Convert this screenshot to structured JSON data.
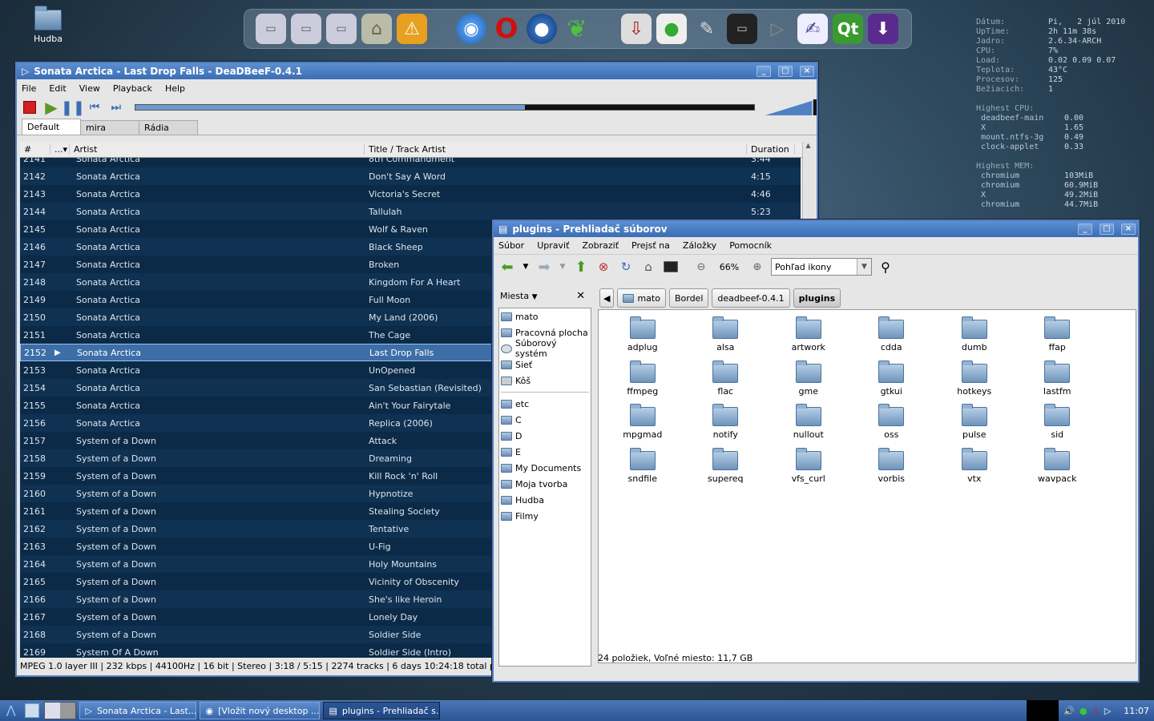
{
  "desktop": {
    "icon_label": "Hudba"
  },
  "dock": {
    "icons": [
      "drive-icon",
      "drive-icon",
      "drive-icon",
      "home-icon",
      "warning-icon",
      "chromium-icon",
      "opera-icon",
      "firefox-icon",
      "leaf-icon",
      "download-manager-icon",
      "chat-icon",
      "gimp-icon",
      "terminal-icon",
      "play-icon",
      "notes-icon",
      "qt-icon",
      "download-icon"
    ],
    "qt_label": "Qt"
  },
  "conky": {
    "rows": [
      [
        "Dátum:",
        "Pi,   2 júl 2010"
      ],
      [
        "UpTime:",
        "2h 11m 38s"
      ],
      [
        "Jadro:",
        "2.6.34-ARCH"
      ],
      [
        "CPU:",
        "7%"
      ],
      [
        "Load:",
        "0.02 0.09 0.07"
      ],
      [
        "Teplota:",
        "43°C"
      ],
      [
        "Procesov:",
        "125"
      ],
      [
        "Bežiacich:",
        "1"
      ]
    ],
    "cpu_title": "Highest CPU:",
    "cpu": [
      [
        "deadbeef-main",
        "0.00"
      ],
      [
        "X",
        "1.65"
      ],
      [
        "mount.ntfs-3g",
        "0.49"
      ],
      [
        "clock-applet",
        "0.33"
      ]
    ],
    "mem_title": "Highest MEM:",
    "mem": [
      [
        "chromium",
        "103MiB"
      ],
      [
        "chromium",
        "60.9MiB"
      ],
      [
        "X",
        "49.2MiB"
      ],
      [
        "chromium",
        "44.7MiB"
      ]
    ]
  },
  "deadbeef": {
    "title": "Sonata Arctica - Last Drop Falls - DeaDBeeF-0.4.1",
    "menu": [
      "File",
      "Edit",
      "View",
      "Playback",
      "Help"
    ],
    "seek_fraction": 0.63,
    "tabs": [
      "Default",
      "mira",
      "Rádia"
    ],
    "columns": [
      "#",
      "...",
      "Artist",
      "Title / Track Artist",
      "Duration"
    ],
    "tracks": [
      [
        "2141",
        "Sonata Arctica",
        "8th Commandment",
        "3:44"
      ],
      [
        "2142",
        "Sonata Arctica",
        "Don't Say A Word",
        "4:15"
      ],
      [
        "2143",
        "Sonata Arctica",
        "Victoria's Secret",
        "4:46"
      ],
      [
        "2144",
        "Sonata Arctica",
        "Tallulah",
        "5:23"
      ],
      [
        "2145",
        "Sonata Arctica",
        "Wolf & Raven",
        ""
      ],
      [
        "2146",
        "Sonata Arctica",
        "Black Sheep",
        ""
      ],
      [
        "2147",
        "Sonata Arctica",
        "Broken",
        ""
      ],
      [
        "2148",
        "Sonata Arctica",
        "Kingdom For A Heart",
        ""
      ],
      [
        "2149",
        "Sonata Arctica",
        "Full Moon",
        ""
      ],
      [
        "2150",
        "Sonata Arctica",
        "My Land (2006)",
        ""
      ],
      [
        "2151",
        "Sonata Arctica",
        "The Cage",
        ""
      ],
      [
        "2152",
        "Sonata Arctica",
        "Last Drop Falls",
        ""
      ],
      [
        "2153",
        "Sonata Arctica",
        "UnOpened",
        ""
      ],
      [
        "2154",
        "Sonata Arctica",
        "San Sebastian (Revisited)",
        ""
      ],
      [
        "2155",
        "Sonata Arctica",
        "Ain't Your Fairytale",
        ""
      ],
      [
        "2156",
        "Sonata Arctica",
        "Replica (2006)",
        ""
      ],
      [
        "2157",
        "System of a Down",
        "Attack",
        ""
      ],
      [
        "2158",
        "System of a Down",
        "Dreaming",
        ""
      ],
      [
        "2159",
        "System of a Down",
        "Kill Rock 'n' Roll",
        ""
      ],
      [
        "2160",
        "System of a Down",
        "Hypnotize",
        ""
      ],
      [
        "2161",
        "System of a Down",
        "Stealing Society",
        ""
      ],
      [
        "2162",
        "System of a Down",
        "Tentative",
        ""
      ],
      [
        "2163",
        "System of a Down",
        "U-Fig",
        ""
      ],
      [
        "2164",
        "System of a Down",
        "Holy Mountains",
        ""
      ],
      [
        "2165",
        "System of a Down",
        "Vicinity of Obscenity",
        ""
      ],
      [
        "2166",
        "System of a Down",
        "She's like Heroin",
        ""
      ],
      [
        "2167",
        "System of a Down",
        "Lonely Day",
        ""
      ],
      [
        "2168",
        "System of a Down",
        "Soldier Side",
        ""
      ],
      [
        "2169",
        "System Of A Down",
        "Soldier Side (Intro)",
        ""
      ]
    ],
    "playing_index": 11,
    "status": "MPEG 1.0 layer III |  232 kbps | 44100Hz | 16 bit | Stereo | 3:18 / 5:15 | 2274 tracks | 6 days 10:24:18 total playtime"
  },
  "nautilus": {
    "title": "plugins - Prehliadač súborov",
    "menu": [
      "Súbor",
      "Upraviť",
      "Zobraziť",
      "Prejsť na",
      "Záložky",
      "Pomocník"
    ],
    "zoom": "66%",
    "view_mode": "Pohľad ikony",
    "sidebar_title": "Miesta",
    "places": [
      "mato",
      "Pracovná plocha",
      "Súborový systém",
      "Sieť",
      "Kôš"
    ],
    "bookmarks": [
      "etc",
      "C",
      "D",
      "E",
      "My Documents",
      "Moja tvorba",
      "Hudba",
      "Filmy"
    ],
    "breadcrumbs": [
      "mato",
      "Bordel",
      "deadbeef-0.4.1",
      "plugins"
    ],
    "folders": [
      "adplug",
      "alsa",
      "artwork",
      "cdda",
      "dumb",
      "ffap",
      "ffmpeg",
      "flac",
      "gme",
      "gtkui",
      "hotkeys",
      "lastfm",
      "mpgmad",
      "notify",
      "nullout",
      "oss",
      "pulse",
      "sid",
      "sndfile",
      "supereq",
      "vfs_curl",
      "vorbis",
      "vtx",
      "wavpack"
    ],
    "status": "24 položiek, Voľné miesto: 11,7 GB"
  },
  "taskbar": {
    "tasks": [
      "Sonata Arctica - Last...",
      "[Vložit nový desktop ...",
      "plugins - Prehliadač s..."
    ],
    "clock": "11:07"
  },
  "colors": {
    "playlist_bg": "#0b2a47",
    "playlist_alt": "#0f3152",
    "selected": "#3d6ea8",
    "titlebar": "#3b6db4"
  }
}
